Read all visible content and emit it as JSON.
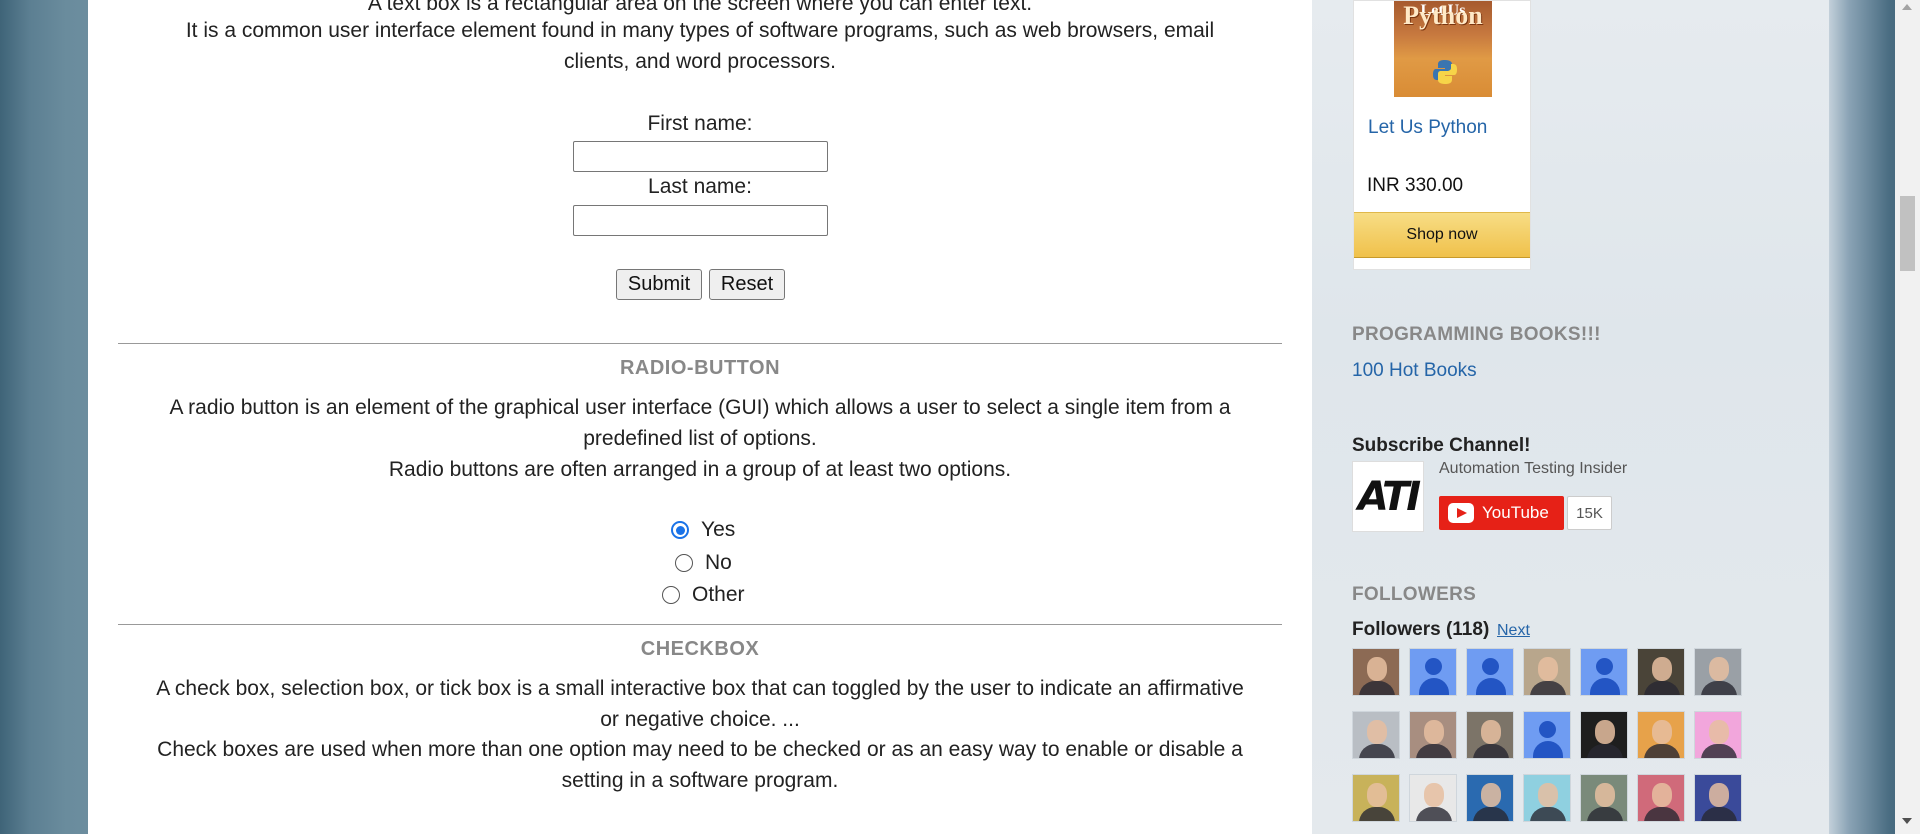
{
  "textbox_section": {
    "desc_line_top": "A text box is a rectangular area on the screen where you can enter text.",
    "desc_line_2": "It is a common user interface element found in many types of software programs, such as web browsers, email",
    "desc_line_3": "clients, and word processors.",
    "first_name_label": "First name:",
    "first_name_value": "",
    "last_name_label": "Last name:",
    "last_name_value": "",
    "submit_label": "Submit",
    "reset_label": "Reset"
  },
  "radio_section": {
    "title": "RADIO-BUTTON",
    "desc_line_1": "A radio button is an element of the graphical user interface (GUI) which allows a user to select a single item from a",
    "desc_line_2": "predefined list of options.",
    "desc_line_3": "Radio buttons are often arranged in a group of at least two options.",
    "options": [
      {
        "label": "Yes",
        "checked": true
      },
      {
        "label": "No",
        "checked": false
      },
      {
        "label": "Other",
        "checked": false
      }
    ]
  },
  "checkbox_section": {
    "title": "CHECKBOX",
    "desc_line_1": "A check box, selection box, or tick box is a small interactive box that can toggled by the user to indicate an affirmative",
    "desc_line_2": "or negative choice. ...",
    "desc_line_3": "Check boxes are used when more than one option may need to be checked or as an easy way to enable or disable a",
    "desc_line_4": "setting in a software program."
  },
  "sidebar": {
    "ad": {
      "book_cover_line1": "Let Us",
      "book_cover_line2": "Python",
      "title": "Let Us Python",
      "price": "INR 330.00",
      "shop_label": "Shop now"
    },
    "programming_books": {
      "title": "PROGRAMMING BOOKS!!!",
      "link": "100 Hot Books"
    },
    "subscribe": {
      "title": "Subscribe Channel!",
      "logo_text": "ATI",
      "channel_name": "Automation Testing Insider",
      "youtube_label": "YouTube",
      "subscriber_count": "15K"
    },
    "followers": {
      "title": "FOLLOWERS",
      "heading": "Followers (118)",
      "next_label": "Next",
      "avatars": [
        {
          "kind": "photo",
          "color": "#8c6a54"
        },
        {
          "kind": "default",
          "color": "#6f9cf2"
        },
        {
          "kind": "default",
          "color": "#6f9cf2"
        },
        {
          "kind": "photo",
          "color": "#b8a68c"
        },
        {
          "kind": "default",
          "color": "#6f9cf2"
        },
        {
          "kind": "photo",
          "color": "#4a4438"
        },
        {
          "kind": "photo",
          "color": "#9aa0a6"
        },
        {
          "kind": "photo",
          "color": "#b9bec4"
        },
        {
          "kind": "photo",
          "color": "#a88e80"
        },
        {
          "kind": "photo",
          "color": "#7c7468"
        },
        {
          "kind": "default",
          "color": "#6f9cf2"
        },
        {
          "kind": "photo",
          "color": "#1e1e1e"
        },
        {
          "kind": "photo",
          "color": "#e7a24a"
        },
        {
          "kind": "photo",
          "color": "#f2a6dc"
        },
        {
          "kind": "photo",
          "color": "#c8b25a"
        },
        {
          "kind": "photo",
          "color": "#e8e8e8"
        },
        {
          "kind": "photo",
          "color": "#2a6ab0"
        },
        {
          "kind": "photo",
          "color": "#8fd0e0"
        },
        {
          "kind": "photo",
          "color": "#7a8a7a"
        },
        {
          "kind": "photo",
          "color": "#d06a7a"
        },
        {
          "kind": "photo",
          "color": "#3a4a9a"
        }
      ]
    }
  }
}
